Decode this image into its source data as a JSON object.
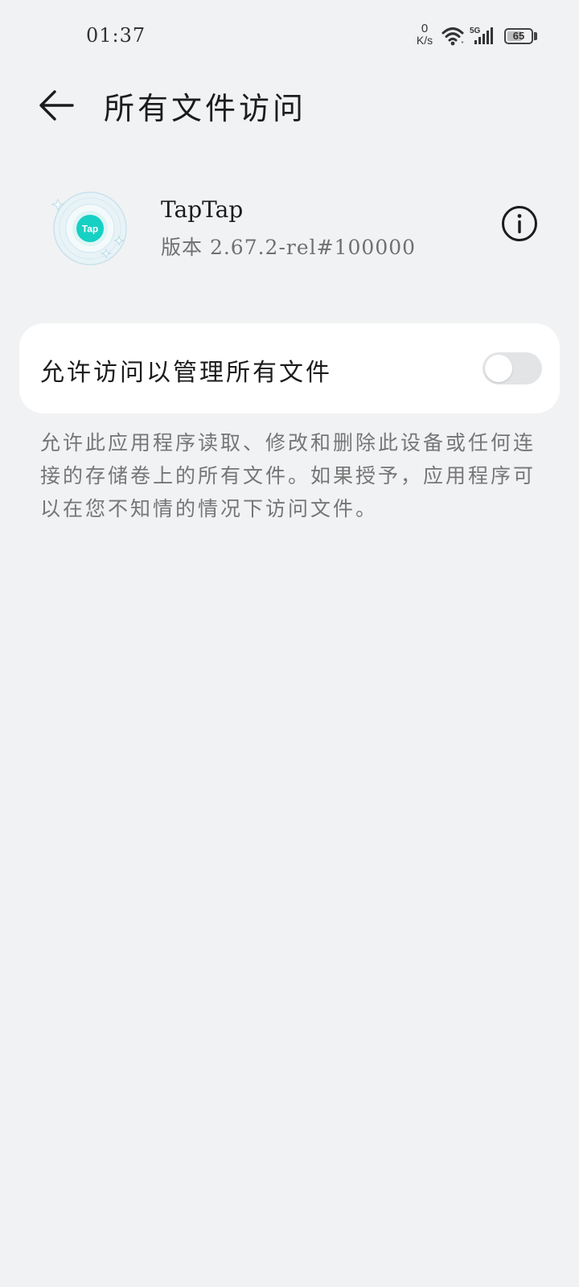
{
  "status_bar": {
    "time": "01:37",
    "net_speed_value": "0",
    "net_speed_unit": "K/s",
    "network_type": "5G",
    "battery_level": "65",
    "battery_fraction": 0.65
  },
  "header": {
    "title": "所有文件访问",
    "back_icon": "arrow-left-icon"
  },
  "app": {
    "name": "TapTap",
    "version": "版本 2.67.2-rel#100000",
    "icon_text": "Tap",
    "info_icon": "info-icon",
    "accent_color": "#16d0c4"
  },
  "permission": {
    "label": "允许访问以管理所有文件",
    "enabled": false,
    "description": "允许此应用程序读取、修改和删除此设备或任何连接的存储卷上的所有文件。如果授予，应用程序可以在您不知情的情况下访问文件。"
  }
}
